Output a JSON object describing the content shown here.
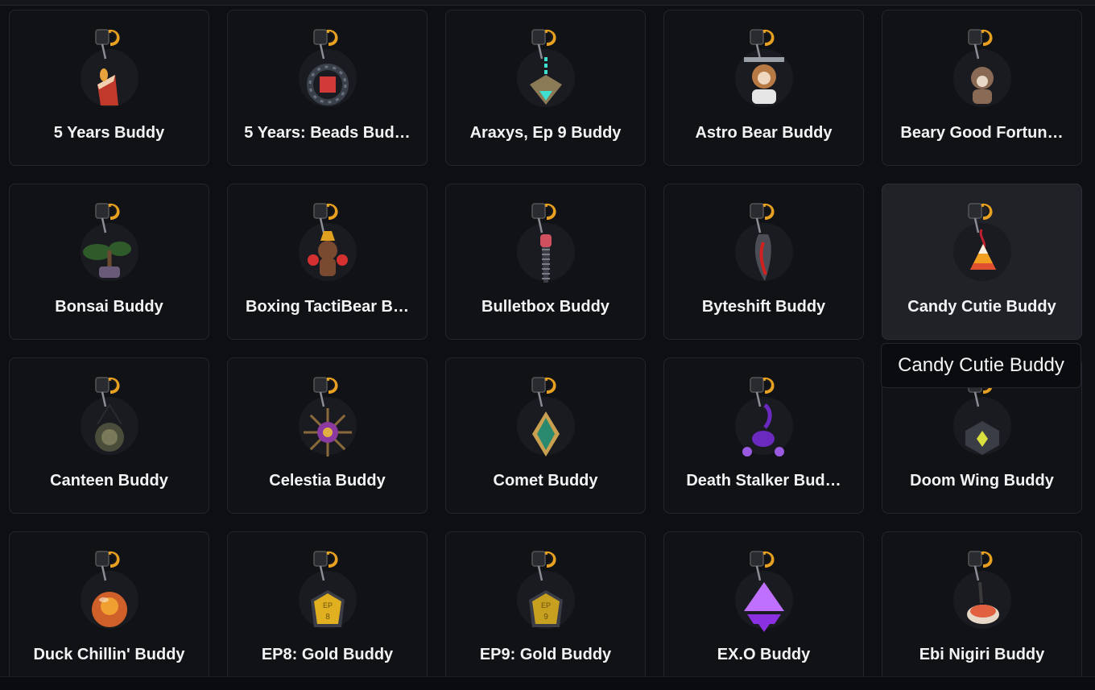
{
  "items": [
    {
      "label": "5 Years Buddy",
      "icon": "cake-slice-charm-icon",
      "color": "#c0392b",
      "accent": "#e8a33d"
    },
    {
      "label": "5 Years: Beads Bud…",
      "icon": "beads-ring-charm-icon",
      "color": "#3a4049",
      "accent": "#d23a3a"
    },
    {
      "label": "Araxys, Ep 9 Buddy",
      "icon": "crystal-heart-charm-icon",
      "color": "#8a7a55",
      "accent": "#3fe0d0"
    },
    {
      "label": "Astro Bear Buddy",
      "icon": "astronaut-bear-charm-icon",
      "color": "#b87a45",
      "accent": "#e6e6e6"
    },
    {
      "label": "Beary Good Fortun…",
      "icon": "fortune-bear-charm-icon",
      "color": "#8a6a55",
      "accent": "#e8d8c8"
    },
    {
      "label": "Bonsai Buddy",
      "icon": "bonsai-tree-charm-icon",
      "color": "#2f5a2a",
      "accent": "#6a5a7a"
    },
    {
      "label": "Boxing TactiBear B…",
      "icon": "boxing-bear-charm-icon",
      "color": "#7a4a30",
      "accent": "#d43030"
    },
    {
      "label": "Bulletbox Buddy",
      "icon": "bulletbox-blade-charm-icon",
      "color": "#3a3d45",
      "accent": "#d05060"
    },
    {
      "label": "Byteshift Buddy",
      "icon": "byteshift-blade-charm-icon",
      "color": "#4a4d55",
      "accent": "#d02020"
    },
    {
      "label": "Candy Cutie Buddy",
      "icon": "candy-corn-charm-icon",
      "color": "#f0a020",
      "accent": "#e05030"
    },
    {
      "label": "Canteen Buddy",
      "icon": "canteen-charm-icon",
      "color": "#4a4d3a",
      "accent": "#7a7a5a"
    },
    {
      "label": "Celestia Buddy",
      "icon": "celestial-sun-charm-icon",
      "color": "#8a6a3a",
      "accent": "#8a3aa0"
    },
    {
      "label": "Comet Buddy",
      "icon": "comet-star-charm-icon",
      "color": "#2a8a70",
      "accent": "#c8a050"
    },
    {
      "label": "Death Stalker Bud…",
      "icon": "scorpion-charm-icon",
      "color": "#6a2ac0",
      "accent": "#9a5ae0"
    },
    {
      "label": "Doom Wing Buddy",
      "icon": "doom-wing-charm-icon",
      "color": "#3a3d45",
      "accent": "#d8e040"
    },
    {
      "label": "Duck Chillin' Buddy",
      "icon": "duck-globe-charm-icon",
      "color": "#d0602a",
      "accent": "#f0a030"
    },
    {
      "label": "EP8: Gold Buddy",
      "icon": "gold-badge-charm-icon",
      "color": "#e0b020",
      "accent": "#8a6a10",
      "badge": "EP 8"
    },
    {
      "label": "EP9: Gold Buddy",
      "icon": "gold-badge-charm-icon",
      "color": "#c8a020",
      "accent": "#8a6a10",
      "badge": "EP 9"
    },
    {
      "label": "EX.O Buddy",
      "icon": "exo-prism-charm-icon",
      "color": "#8a30e0",
      "accent": "#c070ff"
    },
    {
      "label": "Ebi Nigiri Buddy",
      "icon": "ebi-nigiri-charm-icon",
      "color": "#e8d8c8",
      "accent": "#e06040"
    }
  ],
  "hovered_index": 9,
  "tooltip": {
    "text": "Candy Cutie Buddy"
  },
  "clip_color": "#e8a020"
}
